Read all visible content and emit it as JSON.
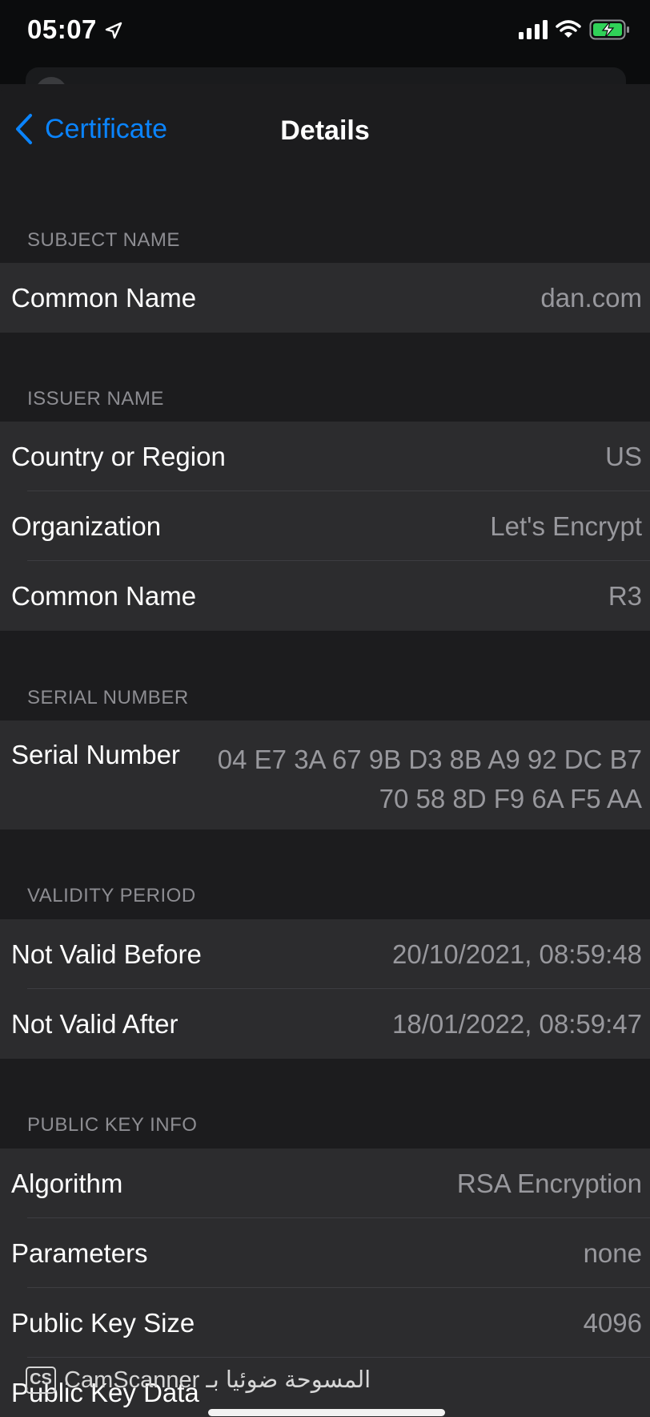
{
  "status_bar": {
    "time": "05:07",
    "battery_color": "#30d158"
  },
  "nav": {
    "back_label": "Certificate",
    "title": "Details"
  },
  "sections": {
    "subject": {
      "header": "SUBJECT NAME",
      "rows": [
        {
          "label": "Common Name",
          "value": "dan.com"
        }
      ]
    },
    "issuer": {
      "header": "ISSUER NAME",
      "rows": [
        {
          "label": "Country or Region",
          "value": "US"
        },
        {
          "label": "Organization",
          "value": "Let's Encrypt"
        },
        {
          "label": "Common Name",
          "value": "R3"
        }
      ]
    },
    "serial": {
      "header": "SERIAL NUMBER",
      "rows": [
        {
          "label": "Serial Number",
          "value": "04 E7 3A 67 9B D3 8B A9 92 DC B7 70 58 8D F9 6A F5 AA"
        }
      ]
    },
    "validity": {
      "header": "VALIDITY PERIOD",
      "rows": [
        {
          "label": "Not Valid Before",
          "value": "20/10/2021, 08:59:48"
        },
        {
          "label": "Not Valid After",
          "value": "18/01/2022, 08:59:47"
        }
      ]
    },
    "public_key": {
      "header": "PUBLIC KEY INFO",
      "rows": [
        {
          "label": "Algorithm",
          "value": "RSA Encryption"
        },
        {
          "label": "Parameters",
          "value": "none"
        },
        {
          "label": "Public Key Size",
          "value": "4096"
        },
        {
          "label": "Public Key Data",
          "value": ""
        }
      ]
    }
  },
  "watermark": {
    "logo": "CS",
    "text": "CamScanner المسوحة ضوئيا بـ"
  }
}
